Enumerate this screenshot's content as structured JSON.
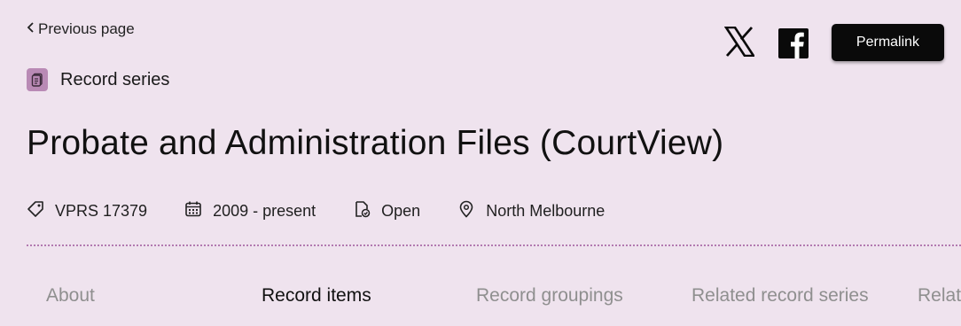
{
  "nav": {
    "previous_label": "Previous page"
  },
  "record_type": {
    "label": "Record series",
    "icon": "document-icon",
    "icon_bg": "#b98ab5"
  },
  "title": "Probate and Administration Files (CourtView)",
  "meta": [
    {
      "icon": "tag-icon",
      "text": "VPRS 17379"
    },
    {
      "icon": "calendar-icon",
      "text": "2009 - present"
    },
    {
      "icon": "open-access-icon",
      "text": "Open"
    },
    {
      "icon": "location-pin-icon",
      "text": "North Melbourne"
    }
  ],
  "share": {
    "x_icon": "x-logo-icon",
    "facebook_icon": "facebook-icon",
    "permalink_label": "Permalink"
  },
  "tabs": [
    {
      "label": "About",
      "active": false
    },
    {
      "label": "Record items",
      "active": true
    },
    {
      "label": "Record groupings",
      "active": false
    },
    {
      "label": "Related record series",
      "active": false
    },
    {
      "label": "Relat",
      "active": false
    }
  ],
  "colors": {
    "background": "#efe3ee",
    "accent": "#b27ab0",
    "button": "#0a0a0a"
  }
}
